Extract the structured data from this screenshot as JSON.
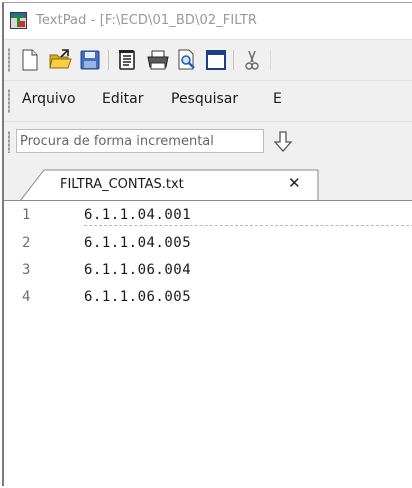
{
  "window": {
    "title": "TextPad - [F:\\ECD\\01_BD\\02_FILTR"
  },
  "toolbar": {
    "buttons": [
      {
        "icon": "new-document-icon",
        "label": "New"
      },
      {
        "icon": "open-folder-icon",
        "label": "Open"
      },
      {
        "icon": "save-icon",
        "label": "Save"
      },
      {
        "icon": "save-all-icon",
        "label": "Save All"
      },
      {
        "icon": "print-icon",
        "label": "Print"
      },
      {
        "icon": "print-preview-icon",
        "label": "Print Preview"
      },
      {
        "icon": "window-icon",
        "label": "Window"
      },
      {
        "icon": "cut-icon",
        "label": "Cut"
      }
    ]
  },
  "menu": {
    "items": [
      "Arquivo",
      "Editar",
      "Pesquisar",
      "E"
    ]
  },
  "search": {
    "placeholder": "Procura de forma incremental",
    "value": ""
  },
  "tabs": [
    {
      "label": "FILTRA_CONTAS.txt",
      "active": true,
      "close_glyph": "✕"
    }
  ],
  "editor": {
    "lines": [
      {
        "number": "1",
        "text": "6.1.1.04.001"
      },
      {
        "number": "2",
        "text": "6.1.1.04.005"
      },
      {
        "number": "3",
        "text": "6.1.1.06.004"
      },
      {
        "number": "4",
        "text": "6.1.1.06.005"
      }
    ],
    "current_line": 1
  },
  "colors": {
    "chrome_background": "#f0f0f0",
    "title_text": "#999999",
    "editor_background": "#ffffff",
    "line_number": "#707070",
    "accent_blue": "#3f6fc2",
    "folder_yellow": "#f2c230"
  }
}
